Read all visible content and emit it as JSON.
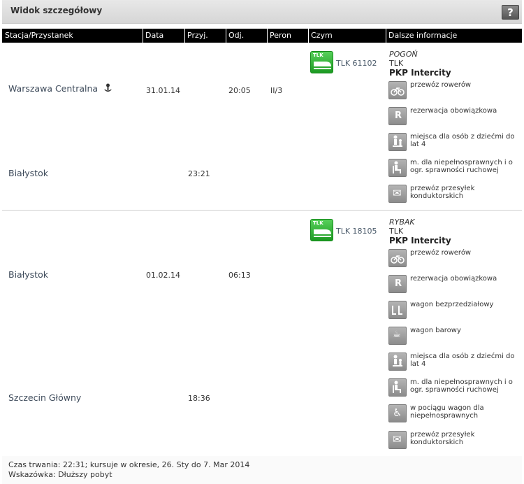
{
  "header": {
    "title": "Widok szczegółowy",
    "help_label": "?"
  },
  "columns": [
    "Stacja/Przystanek",
    "Data",
    "Przyj.",
    "Odj.",
    "Peron",
    "Czym",
    "Dalsze informacje"
  ],
  "legs": [
    {
      "stations": [
        {
          "name": "Warszawa Centralna",
          "date": "31.01.14",
          "arrival": "",
          "departure": "20:05",
          "platform": "II/3"
        },
        {
          "name": "Białystok",
          "date": "",
          "arrival": "23:21",
          "departure": "",
          "platform": ""
        }
      ],
      "train": {
        "logo_text": "TLK",
        "number": "TLK 61102",
        "name": "POGOŃ",
        "category": "TLK",
        "carrier": "PKP Intercity"
      },
      "features": [
        {
          "icon": "bicycle-icon",
          "text": "przewóz rowerów"
        },
        {
          "icon": "reservation-icon",
          "glyph": "R",
          "text": "rezerwacja obowiązkowa"
        },
        {
          "icon": "child-seat-icon",
          "text": "miejsca dla osób z dziećmi do lat 4"
        },
        {
          "icon": "disabled-seat-icon",
          "text": "m. dla niepełnosprawnych i o ogr. sprawności ruchowej"
        },
        {
          "icon": "envelope-icon",
          "glyph": "✉",
          "text": "przewóz przesyłek konduktorskich"
        }
      ]
    },
    {
      "stations": [
        {
          "name": "Białystok",
          "date": "01.02.14",
          "arrival": "",
          "departure": "06:13",
          "platform": ""
        },
        {
          "name": "Szczecin Główny",
          "date": "",
          "arrival": "18:36",
          "departure": "",
          "platform": ""
        }
      ],
      "train": {
        "logo_text": "TLK",
        "number": "TLK 18105",
        "name": "RYBAK",
        "category": "TLK",
        "carrier": "PKP Intercity"
      },
      "features": [
        {
          "icon": "bicycle-icon",
          "text": "przewóz rowerów"
        },
        {
          "icon": "reservation-icon",
          "glyph": "R",
          "text": "rezerwacja obowiązkowa"
        },
        {
          "icon": "open-coach-icon",
          "text": "wagon bezprzedziałowy"
        },
        {
          "icon": "cup-icon",
          "glyph": "☕",
          "text": "wagon barowy"
        },
        {
          "icon": "child-seat-icon",
          "text": "miejsca dla osób z dziećmi do lat 4"
        },
        {
          "icon": "disabled-seat-icon",
          "text": "m. dla niepełnosprawnych i o ogr. sprawności ruchowej"
        },
        {
          "icon": "wheelchair-icon",
          "glyph": "♿",
          "text": "w pociągu wagon dla niepełnosprawnych"
        },
        {
          "icon": "envelope-icon",
          "glyph": "✉",
          "text": "przewóz przesyłek konduktorskich"
        }
      ]
    }
  ],
  "footer": {
    "duration": "Czas trwania: 22:31; kursuje w okresie, 26. Sty do 7. Mar 2014",
    "hint": "Wskazówka: Dłuższy pobyt"
  }
}
